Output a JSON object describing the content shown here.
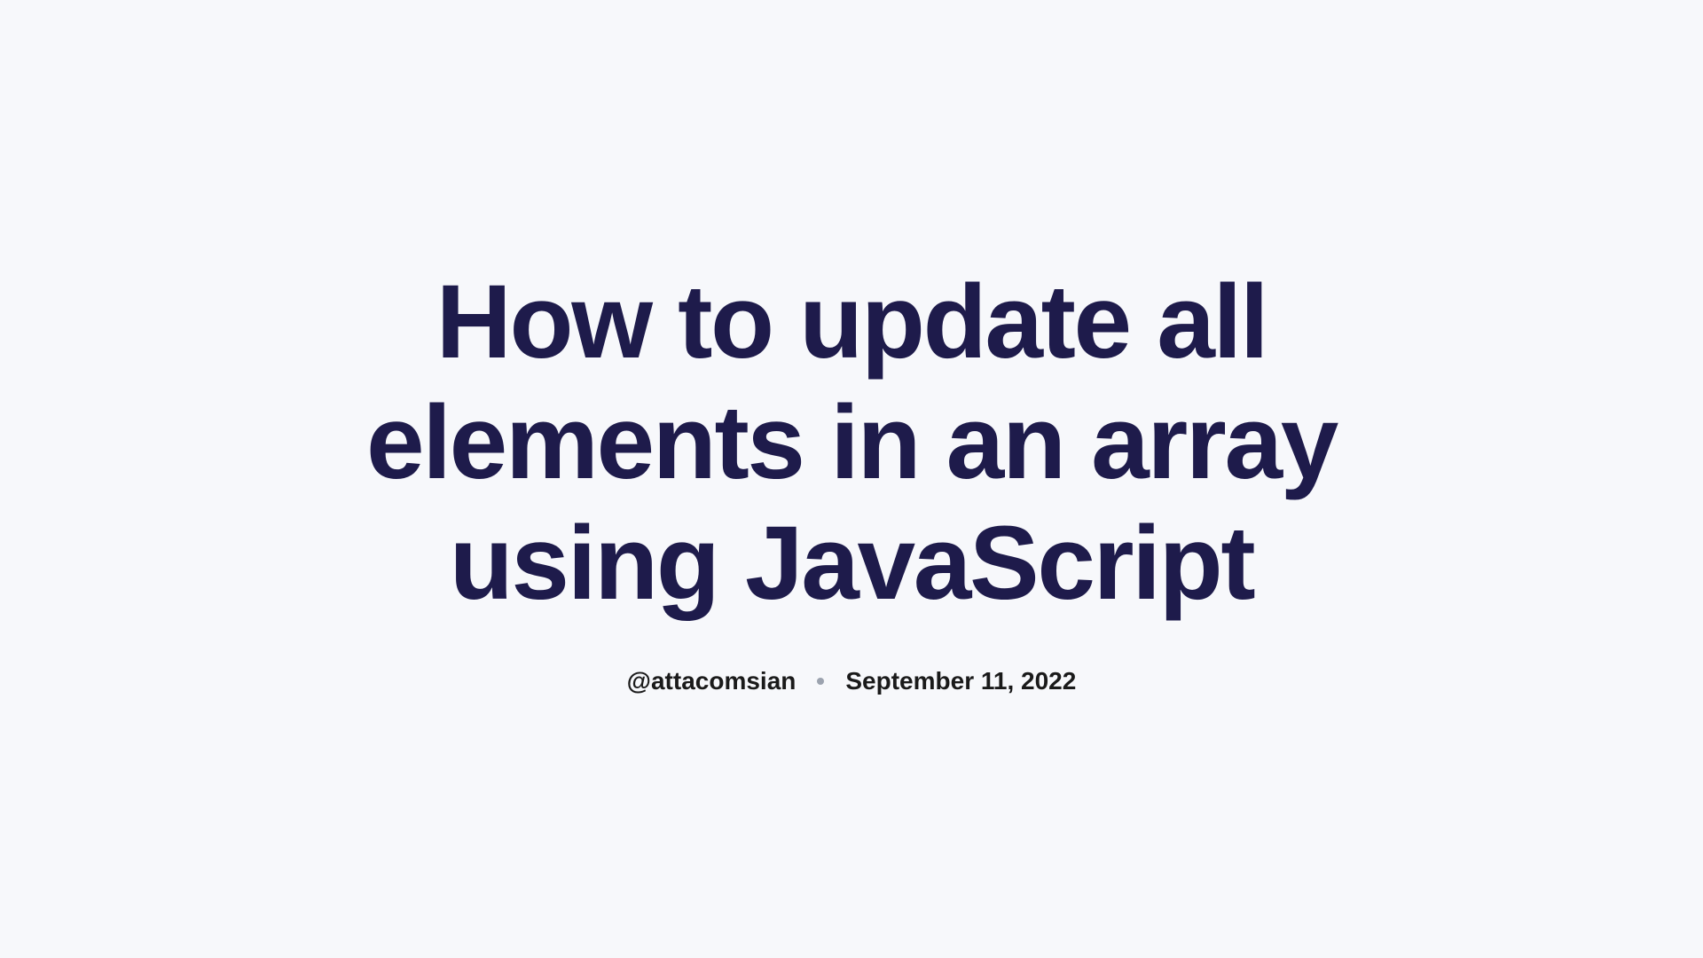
{
  "article": {
    "title": "How to update all elements in an array using JavaScript",
    "author": "@attacomsian",
    "date": "September 11, 2022"
  }
}
